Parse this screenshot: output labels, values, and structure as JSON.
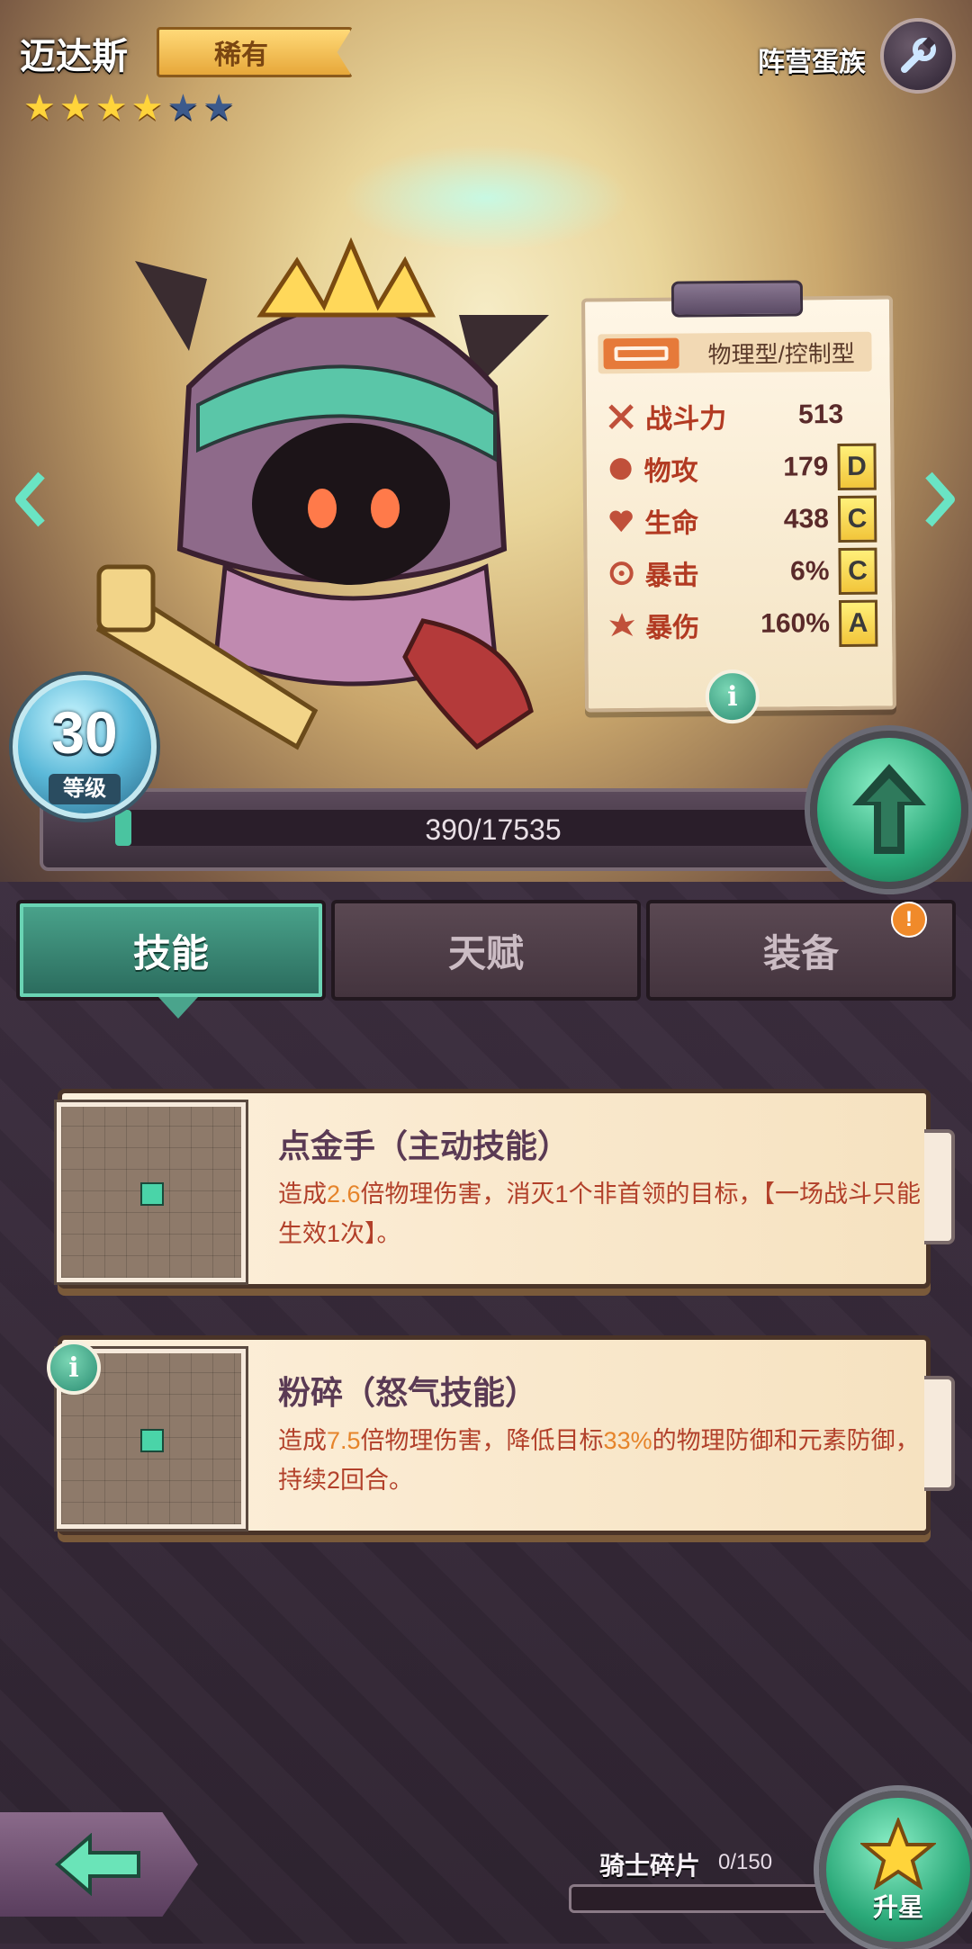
{
  "hero": {
    "name": "迈达斯",
    "rarity": "稀有",
    "stars_total": 6,
    "stars_filled": 4
  },
  "header": {
    "faction": "阵营蛋族",
    "wrench_icon": "wrench-icon"
  },
  "stats": {
    "type": "物理型/控制型",
    "rows": [
      {
        "icon": "crossed-swords-icon",
        "name": "战斗力",
        "value": "513",
        "grade": ""
      },
      {
        "icon": "fist-icon",
        "name": "物攻",
        "value": "179",
        "grade": "D"
      },
      {
        "icon": "heart-icon",
        "name": "生命",
        "value": "438",
        "grade": "C"
      },
      {
        "icon": "crit-icon",
        "name": "暴击",
        "value": "6%",
        "grade": "C"
      },
      {
        "icon": "explosion-icon",
        "name": "暴伤",
        "value": "160%",
        "grade": "A"
      }
    ]
  },
  "level": {
    "value": "30",
    "label": "等级",
    "xp_text": "390/17535",
    "xp_progress": 0.022
  },
  "tabs": [
    {
      "label": "技能",
      "active": true
    },
    {
      "label": "天赋",
      "active": false
    },
    {
      "label": "装备",
      "active": false,
      "alert": "!"
    }
  ],
  "skills": [
    {
      "title": "点金手（主动技能）",
      "desc_parts": [
        "造成",
        "2.6",
        "倍物理伤害，消灭1个非首领的目标，【一场战斗只能生效1次】。"
      ]
    },
    {
      "title": "粉碎（怒气技能）",
      "desc_parts": [
        "造成",
        "7.5",
        "倍物理伤害，降低目标",
        "33%",
        "的物理防御和元素防御，持续2回合。"
      ]
    }
  ],
  "bottom": {
    "shards_label": "骑士碎片",
    "shards_count": "0/150",
    "shards_progress": 0,
    "star_up_label": "升星"
  },
  "colors": {
    "accent_green": "#2aa878",
    "rarity_gold": "#e7a83a",
    "text_red": "#b2402a"
  }
}
